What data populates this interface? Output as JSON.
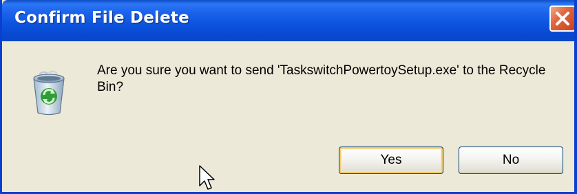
{
  "dialog": {
    "title": "Confirm File Delete",
    "message": "Are you sure you want to send 'TaskswitchPowertoySetup.exe' to the Recycle Bin?",
    "icon": "recycle-bin-icon",
    "buttons": {
      "yes_label": "Yes",
      "no_label": "No"
    }
  },
  "colors": {
    "titlebar_blue": "#0b53dd",
    "dialog_face": "#ece9d8",
    "close_red": "#e2653f",
    "default_button_highlight": "#f7ce6f"
  }
}
